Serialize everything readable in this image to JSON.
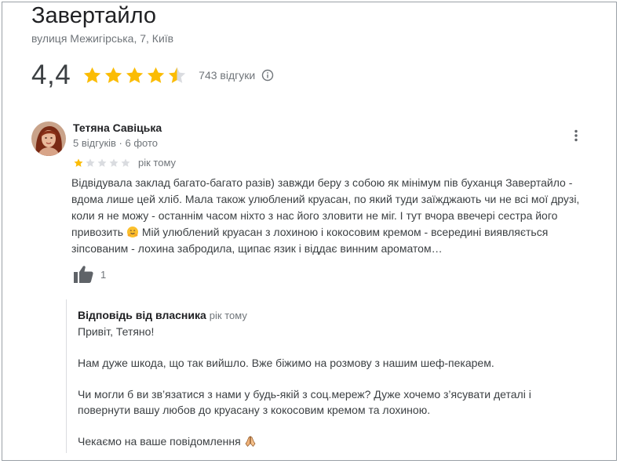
{
  "place": {
    "name": "Завертайло",
    "address": "вулиця Межигірська, 7, Київ",
    "rating": "4,4",
    "rating_value": 4.4,
    "reviews_count": "743 відгуки"
  },
  "review": {
    "author": "Тетяна Савіцька",
    "meta": "5 відгуків · 6 фото",
    "stars": 1,
    "date": "рік тому",
    "lines": [
      "Відвідувала заклад багато-багато разів) завжди беру з собою як мінімум пів буханця Завертайло -",
      "вдома лише цей хліб. Мала також улюблений круасан, по який туди заїжджають чи не всі мої друзі,",
      "коли я не можу - останнім часом ніхто з нас його зловити не міг. І тут вчора ввечері сестра його",
      "привозить",
      "Мій улюблений круасан з лохиною і кокосовим кремом - всередині виявляється",
      "зіпсованим - лохина забродила, щипає язик і віддає винним ароматом…"
    ],
    "likes": "1"
  },
  "owner_reply": {
    "label": "Відповідь від власника",
    "date": "рік тому",
    "lines": [
      "Привіт, Тетяно!",
      "Нам дуже шкода, що так вийшло. Вже біжимо на розмову з нашим шеф-пекарем.",
      "Чи могли б ви зв’язатися з нами у будь-якій з соц.мереж? Дуже хочемо з’ясувати деталі і",
      "повернути вашу любов до круасану з кокосовим кремом та лохиною.",
      "Чекаємо на ваше повідомлення"
    ]
  },
  "colors": {
    "star_filled": "#fbbc04",
    "star_empty": "#dadce0",
    "text_primary": "#202124",
    "text_secondary": "#70757a"
  },
  "icons": {
    "info": "info-circle-icon",
    "more": "more-vert-icon",
    "like": "thumb-up-icon",
    "emoji_review": "hugging-face-emoji",
    "emoji_reply": "praying-hands-emoji"
  }
}
